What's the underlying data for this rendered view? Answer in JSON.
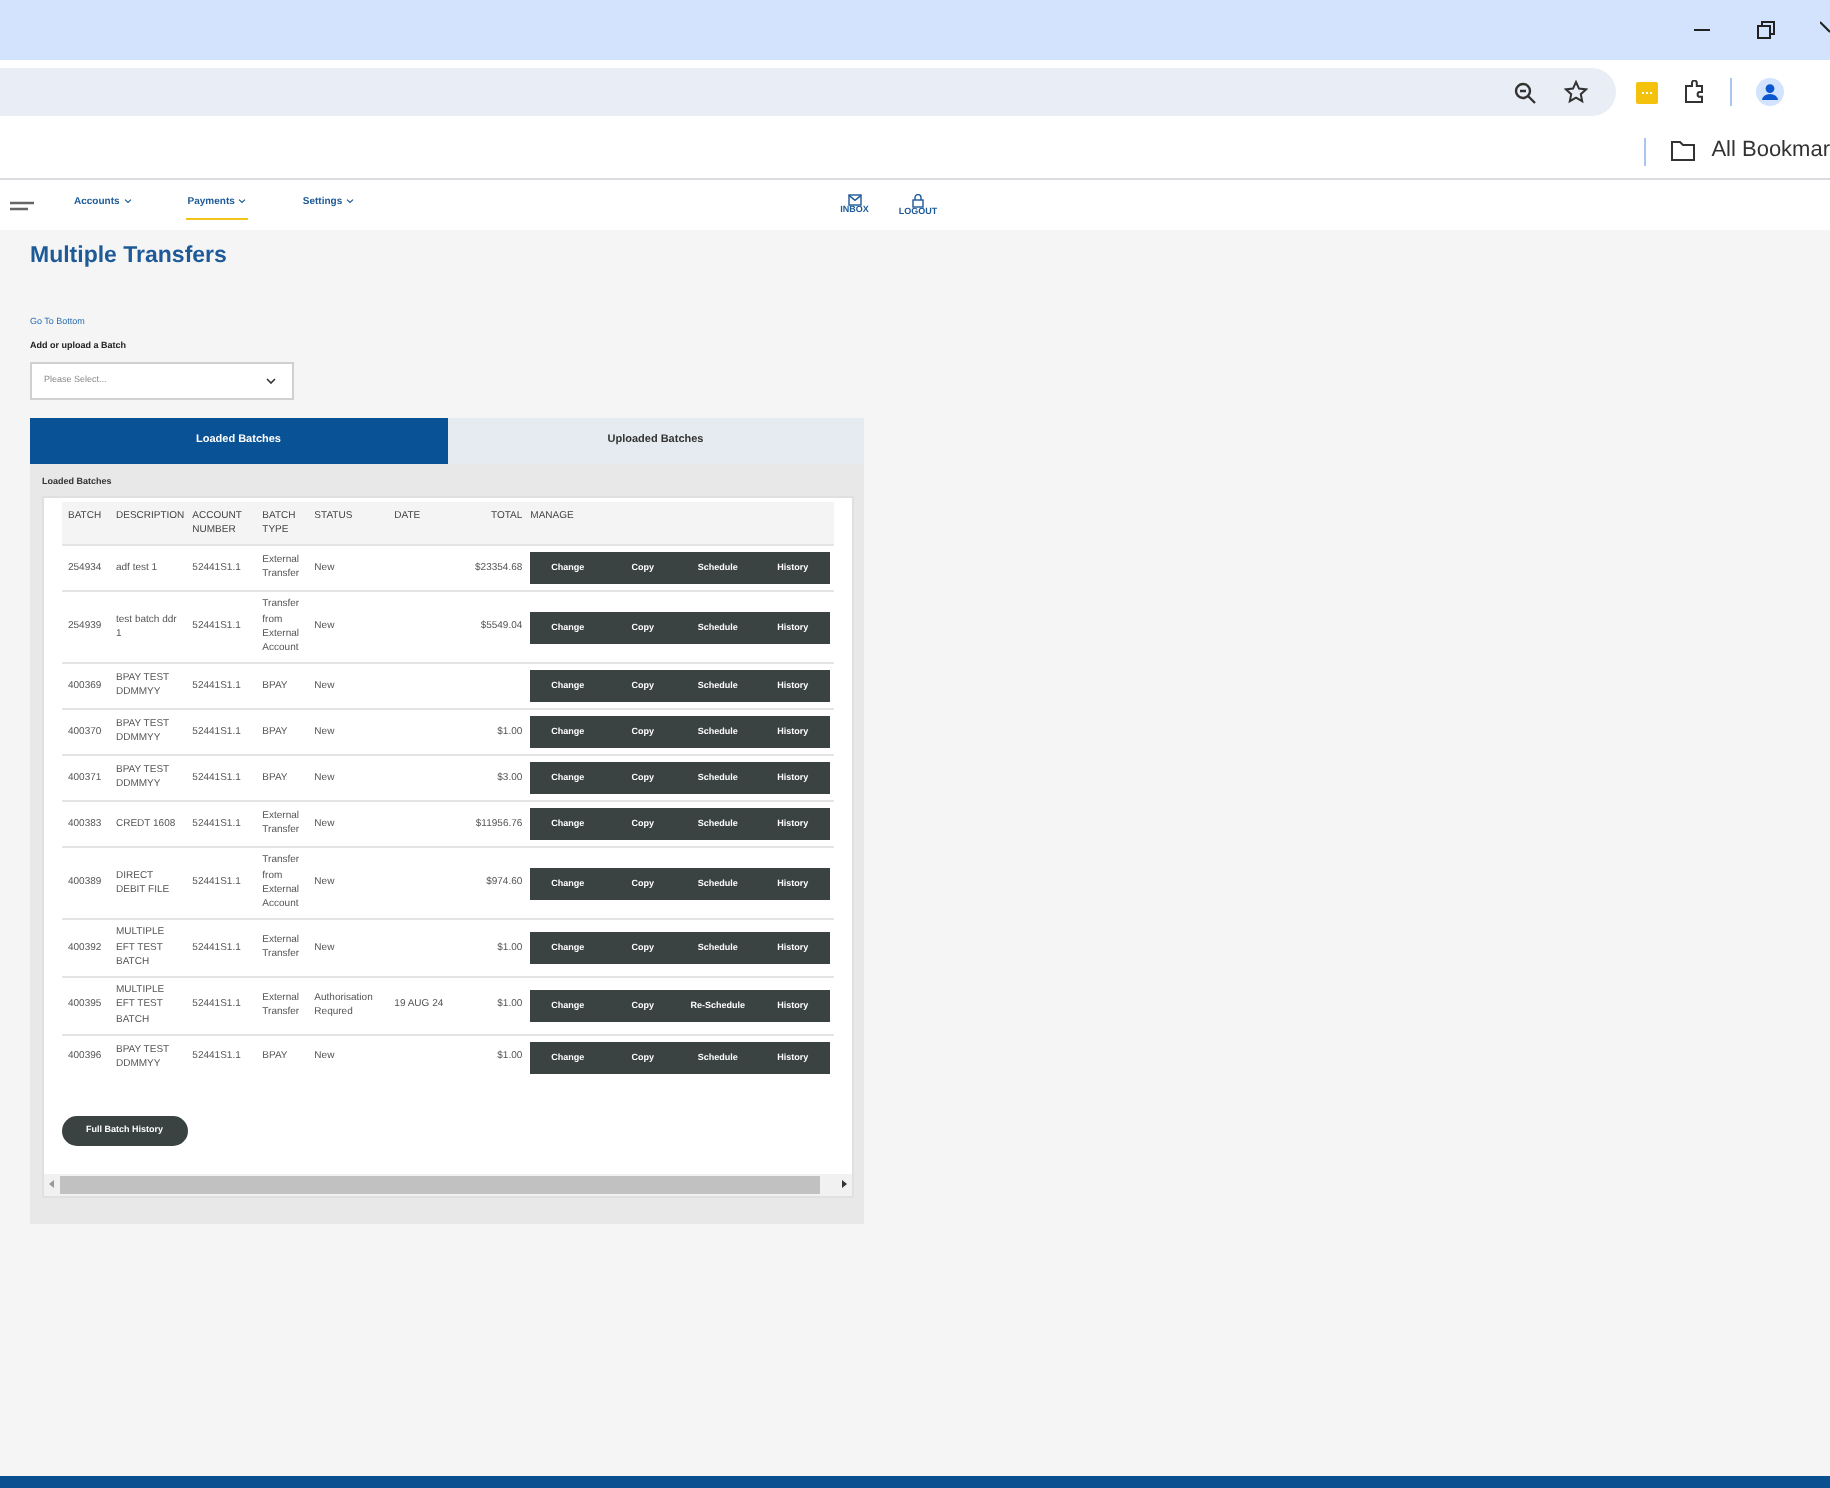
{
  "browser": {
    "bookmarks_label": "All Bookmar"
  },
  "nav": {
    "items": [
      {
        "label": "Accounts",
        "selected": false
      },
      {
        "label": "Payments",
        "selected": true
      },
      {
        "label": "Settings",
        "selected": false
      }
    ],
    "actions": [
      {
        "kind": "inbox",
        "label": "INBOX"
      },
      {
        "kind": "logout",
        "label": "LOGOUT"
      }
    ]
  },
  "page_title": "Multiple Transfers",
  "go_to_bottom": "Go To Bottom",
  "batch_select": {
    "label": "Add or upload a Batch",
    "placeholder": "Please Select..."
  },
  "tabs": [
    {
      "label": "Loaded Batches",
      "selected": true
    },
    {
      "label": "Uploaded Batches",
      "selected": false
    }
  ],
  "section_title": "Loaded Batches",
  "table": {
    "columns": [
      "BATCH",
      "DESCRIPTION",
      "ACCOUNT NUMBER",
      "BATCH TYPE",
      "STATUS",
      "DATE",
      "TOTAL",
      "MANAGE"
    ],
    "rows": [
      {
        "batch": "254934",
        "description": "adf test 1",
        "account": "52441S1.1",
        "type": "External Transfer",
        "status": "New",
        "total": "$23354.68",
        "actions": [
          "Change",
          "Copy",
          "Schedule",
          "History"
        ]
      },
      {
        "batch": "254939",
        "description": "test batch ddr 1",
        "account": "52441S1.1",
        "type": "Transfer from External Account",
        "status": "New",
        "total": "$5549.04",
        "actions": [
          "Change",
          "Copy",
          "Schedule",
          "History"
        ]
      },
      {
        "batch": "400369",
        "description": "BPAY TEST DDMMYY",
        "account": "52441S1.1",
        "type": "BPAY",
        "status": "New",
        "actions": [
          "Change",
          "Copy",
          "Schedule",
          "History"
        ]
      },
      {
        "batch": "400370",
        "description": "BPAY TEST DDMMYY",
        "account": "52441S1.1",
        "type": "BPAY",
        "status": "New",
        "total": "$1.00",
        "actions": [
          "Change",
          "Copy",
          "Schedule",
          "History"
        ]
      },
      {
        "batch": "400371",
        "description": "BPAY TEST DDMMYY",
        "account": "52441S1.1",
        "type": "BPAY",
        "status": "New",
        "total": "$3.00",
        "actions": [
          "Change",
          "Copy",
          "Schedule",
          "History"
        ]
      },
      {
        "batch": "400383",
        "description": "CREDT 1608",
        "account": "52441S1.1",
        "type": "External Transfer",
        "status": "New",
        "total": "$11956.76",
        "actions": [
          "Change",
          "Copy",
          "Schedule",
          "History"
        ]
      },
      {
        "batch": "400389",
        "description": "DIRECT DEBIT FILE",
        "account": "52441S1.1",
        "type": "Transfer from External Account",
        "status": "New",
        "total": "$974.60",
        "actions": [
          "Change",
          "Copy",
          "Schedule",
          "History"
        ]
      },
      {
        "batch": "400392",
        "description": "MULTIPLE EFT TEST BATCH",
        "account": "52441S1.1",
        "type": "External Transfer",
        "status": "New",
        "total": "$1.00",
        "actions": [
          "Change",
          "Copy",
          "Schedule",
          "History"
        ]
      },
      {
        "batch": "400395",
        "description": "MULTIPLE EFT TEST BATCH",
        "account": "52441S1.1",
        "type": "External Transfer",
        "status": "Authorisation Requred",
        "date": "19 AUG 24",
        "total": "$1.00",
        "actions": [
          "Change",
          "Copy",
          "Re-Schedule",
          "History"
        ]
      },
      {
        "batch": "400396",
        "description": "BPAY TEST DDMMYY",
        "account": "52441S1.1",
        "type": "BPAY",
        "status": "New",
        "total": "$1.00",
        "actions": [
          "Change",
          "Copy",
          "Schedule",
          "History"
        ]
      }
    ]
  },
  "full_history_button": "Full Batch History"
}
